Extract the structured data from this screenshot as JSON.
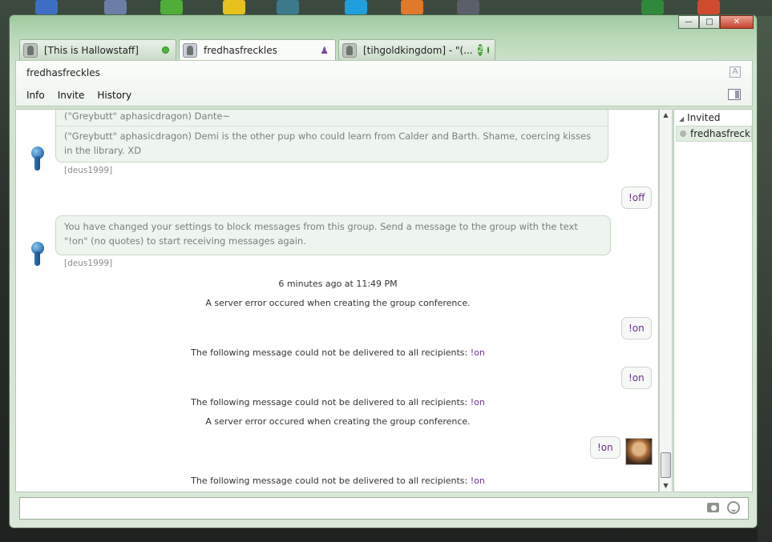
{
  "window": {
    "minimize_icon": "minimize-icon",
    "maximize_icon": "maximize-icon",
    "close_icon": "close-icon"
  },
  "tabs": [
    {
      "label": "[This is Hallowstaff]",
      "status": "online",
      "active": false
    },
    {
      "label": "fredhasfreckles",
      "active": true,
      "icon": "group-people-icon"
    },
    {
      "label": "[tihgoldkingdom] - \"(...",
      "badge": "2",
      "status": "online",
      "active": false
    }
  ],
  "header": {
    "title": "fredhasfreckles",
    "font_toggle": "A",
    "menu": [
      "Info",
      "Invite",
      "History"
    ]
  },
  "roster": {
    "group_label": "Invited",
    "members": [
      "fredhasfreck..."
    ]
  },
  "messages": {
    "in1": {
      "lines": [
        "(\"Greybutt\" aphasicdragon) Dante~",
        "(\"Greybutt\" aphasicdragon) Demi is the other pup who could learn from Calder and Barth. Shame, coercing kisses in the library. XD"
      ],
      "sender": "[deus1999]"
    },
    "out1": "!off",
    "in2": {
      "text": "You have changed your settings to block messages from this group. Send a message to the group with the text \"!on\" (no quotes) to start receiving messages again.",
      "sender": "[deus1999]"
    },
    "timestamp": "6 minutes ago at 11:49 PM",
    "server_error": "A server error occured when creating the group conference.",
    "not_delivered": "The following message could not be delivered to all recipients:",
    "on_cmd": "!on"
  },
  "colors": {
    "accent_purple": "#6a2f8a",
    "online_green": "#4fb53d",
    "chrome_green": "#b7d8b6"
  }
}
